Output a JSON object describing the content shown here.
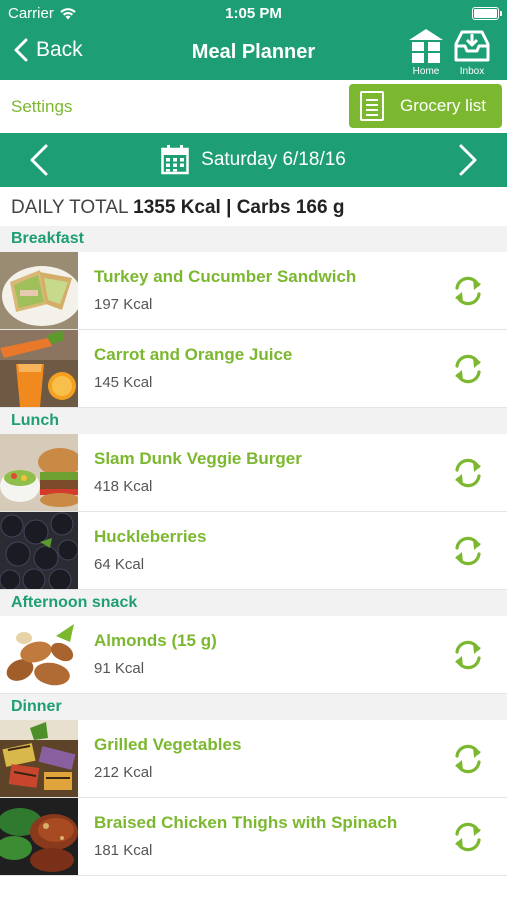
{
  "status_bar": {
    "carrier": "Carrier",
    "time": "1:05 PM"
  },
  "nav": {
    "back_label": "Back",
    "title": "Meal Planner",
    "home_label": "Home",
    "inbox_label": "Inbox"
  },
  "toolbar": {
    "settings_label": "Settings",
    "grocery_label": "Grocery list"
  },
  "date": {
    "label": "Saturday 6/18/16"
  },
  "totals": {
    "label": "DAILY TOTAL",
    "value": "1355 Kcal | Carbs 166 g"
  },
  "sections": [
    {
      "title": "Breakfast",
      "items": [
        {
          "name": "Turkey and Cucumber Sandwich",
          "kcal": "197 Kcal",
          "image": "sandwich-photo"
        },
        {
          "name": "Carrot and Orange Juice",
          "kcal": "145 Kcal",
          "image": "carrot-juice-photo"
        }
      ]
    },
    {
      "title": "Lunch",
      "items": [
        {
          "name": "Slam Dunk Veggie Burger",
          "kcal": "418 Kcal",
          "image": "veggie-burger-photo"
        },
        {
          "name": "Huckleberries",
          "kcal": "64 Kcal",
          "image": "berries-photo"
        }
      ]
    },
    {
      "title": "Afternoon snack",
      "items": [
        {
          "name": "Almonds (15 g)",
          "kcal": "91 Kcal",
          "image": "almonds-photo"
        }
      ]
    },
    {
      "title": "Dinner",
      "items": [
        {
          "name": "Grilled Vegetables",
          "kcal": "212 Kcal",
          "image": "grilled-vegetables-photo"
        },
        {
          "name": "Braised Chicken Thighs with Spinach",
          "kcal": "181 Kcal",
          "image": "chicken-spinach-photo"
        }
      ]
    }
  ],
  "colors": {
    "primary": "#1e9e74",
    "accent": "#7cb82f",
    "section_bg": "#f2f2f2"
  },
  "icons": {
    "swap": "refresh-icon",
    "home": "home-icon",
    "inbox": "inbox-download-icon",
    "calendar": "calendar-icon"
  }
}
